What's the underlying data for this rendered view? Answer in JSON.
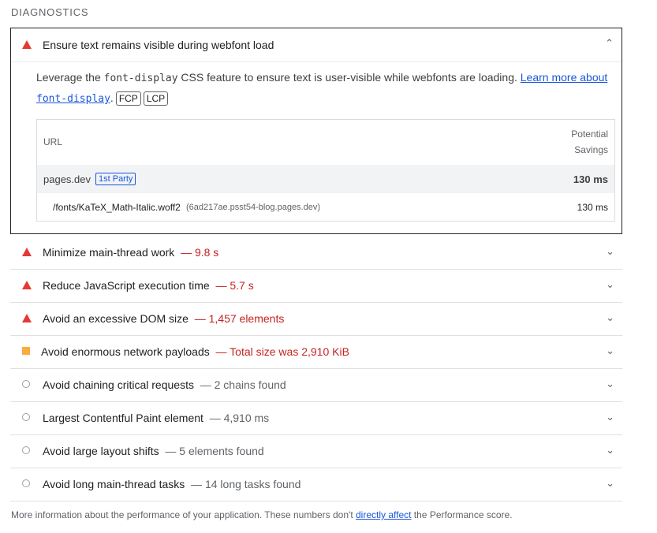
{
  "section": {
    "title": "DIAGNOSTICS"
  },
  "expanded": {
    "title": "Ensure text remains visible during webfont load",
    "chevron": "chevron-up-icon",
    "description": {
      "text_before": "Leverage the ",
      "code": "font-display",
      "text_mid": " CSS feature to ensure text is user-visible while webfonts are loading. ",
      "link_text": "Learn more about",
      "link_code": "font-display",
      "period": ".",
      "tags": [
        "FCP",
        "LCP"
      ]
    },
    "table": {
      "header_url": "URL",
      "header_savings_line1": "Potential",
      "header_savings_line2": "Savings",
      "party": {
        "url": "pages.dev",
        "badge": "1st Party",
        "value": "130 ms"
      },
      "item": {
        "url": "/fonts/KaTeX_Math-Italic.woff2",
        "host": "(6ad217ae.psst54-blog.pages.dev)",
        "value": "130 ms"
      }
    }
  },
  "audits": [
    {
      "icon": "fail-triangle-icon",
      "title": "Minimize main-thread work",
      "display": "— 9.8 s",
      "tone": "red"
    },
    {
      "icon": "fail-triangle-icon",
      "title": "Reduce JavaScript execution time",
      "display": "— 5.7 s",
      "tone": "red"
    },
    {
      "icon": "fail-triangle-icon",
      "title": "Avoid an excessive DOM size",
      "display": "— 1,457 elements",
      "tone": "red"
    },
    {
      "icon": "average-square-icon",
      "title": "Avoid enormous network payloads",
      "display": "— Total size was 2,910 KiB",
      "tone": "red"
    },
    {
      "icon": "info-circle-icon",
      "title": "Avoid chaining critical requests",
      "display": "— 2 chains found",
      "tone": "grey"
    },
    {
      "icon": "info-circle-icon",
      "title": "Largest Contentful Paint element",
      "display": "— 4,910 ms",
      "tone": "grey"
    },
    {
      "icon": "info-circle-icon",
      "title": "Avoid large layout shifts",
      "display": "— 5 elements found",
      "tone": "grey"
    },
    {
      "icon": "info-circle-icon",
      "title": "Avoid long main-thread tasks",
      "display": "— 14 long tasks found",
      "tone": "grey"
    }
  ],
  "footer": {
    "text_before": "More information about the performance of your application. These numbers don't ",
    "link_text": "directly affect",
    "text_after": " the Performance score."
  },
  "colors": {
    "fail": "#e53935",
    "average": "#fbab3b",
    "info": "#9aa0a6",
    "link": "#1a56db"
  }
}
